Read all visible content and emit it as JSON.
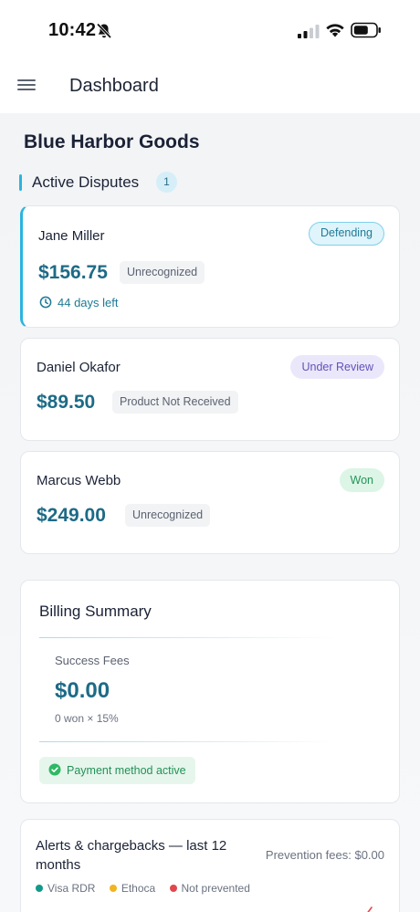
{
  "status_bar": {
    "time": "10:42",
    "icons": [
      "bell-slash-icon",
      "signal-icon",
      "wifi-icon",
      "battery-icon"
    ]
  },
  "header": {
    "title": "Dashboard",
    "menu_icon": "hamburger-menu-icon"
  },
  "merchant": {
    "name": "Blue Harbor Goods"
  },
  "disputes_section": {
    "title": "Active Disputes",
    "count": "1",
    "cards": [
      {
        "customer": "Jane Miller",
        "amount": "$156.75",
        "reason": "Unrecognized",
        "status": "Defending",
        "days_left": "44 days left"
      },
      {
        "customer": "Daniel Okafor",
        "amount": "$89.50",
        "reason": "Product Not Received",
        "status": "Under Review"
      },
      {
        "customer": "Marcus Webb",
        "amount": "$249.00",
        "reason": "Unrecognized",
        "status": "Won"
      }
    ]
  },
  "billing": {
    "title": "Billing Summary",
    "fees_label": "Success Fees",
    "fees_value": "$0.00",
    "fees_calc": "0 won × 15%",
    "payment_status": "Payment method active"
  },
  "alerts": {
    "title": "Alerts & chargebacks — last 12 months",
    "prevention_fees": "Prevention fees: $0.00",
    "legend": [
      {
        "label": "Visa RDR",
        "color": "#12998a"
      },
      {
        "label": "Ethoca",
        "color": "#f2b41f"
      },
      {
        "label": "Not prevented",
        "color": "#e2474b"
      }
    ]
  },
  "colors": {
    "accent": "#2bb4e0",
    "amount": "#1d6b86",
    "defending": "#1e7a96",
    "under_review": "#6252b8",
    "won": "#23945a"
  }
}
